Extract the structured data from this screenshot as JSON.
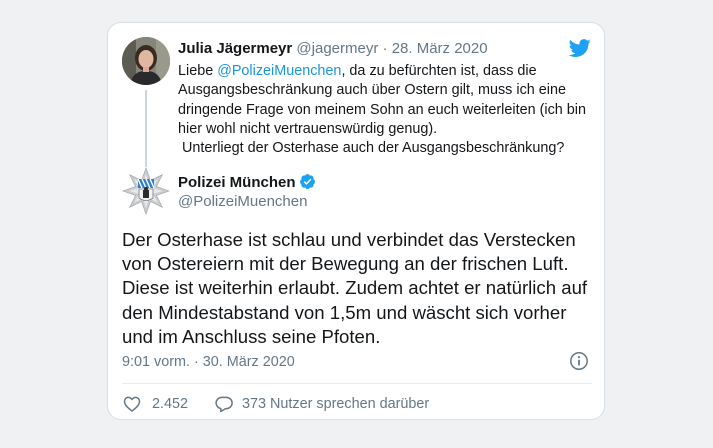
{
  "reply": {
    "author_name": "Julia Jägermeyr",
    "author_handle": "@jagermeyr",
    "separator": "·",
    "date": "28. März 2020",
    "text_prefix": "Liebe ",
    "mention": "@PolizeiMuenchen",
    "text_body": ", da zu befürchten ist, dass die Ausgangsbeschränkung auch über Ostern gilt, muss ich eine dringende Frage von meinem Sohn an euch weiterleiten (ich bin hier wohl nicht vertrauenswürdig genug).\n Unterliegt der Osterhase auch der Ausgangsbeschränkung?"
  },
  "tweet": {
    "author_name": "Polizei München",
    "author_handle": "@PolizeiMuenchen",
    "text": "Der Osterhase ist schlau und verbindet das Verstecken von Ostereiern mit der Bewegung an der frischen Luft. Diese ist weiterhin erlaubt. Zudem achtet er natürlich auf den Mindestabstand von 1,5m und wäscht sich vorher und im Anschluss seine Pfoten.",
    "timestamp": "9:01 vorm. · 30. März 2020",
    "likes": "2.452",
    "replies_label": "373 Nutzer sprechen darüber"
  },
  "icons": {
    "brand": "twitter-bird-icon",
    "verified": "verified-badge-icon",
    "info": "info-icon",
    "like": "heart-icon",
    "reply": "speech-bubble-icon"
  },
  "colors": {
    "link": "#1b95e0",
    "twitter_blue": "#1da1f2",
    "muted": "#657786",
    "text": "#14171a"
  }
}
